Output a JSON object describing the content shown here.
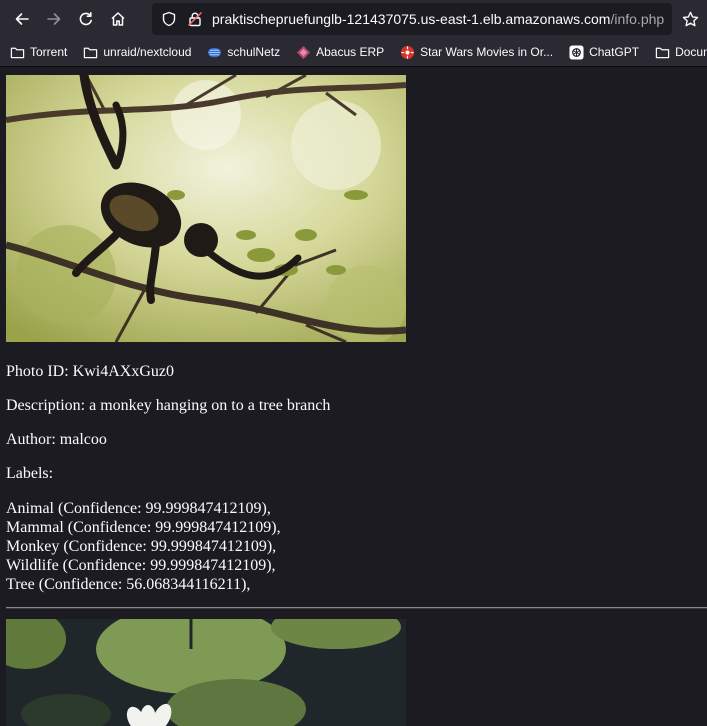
{
  "browser": {
    "url_host": "praktischepruefunglb-121437075.us-east-1.elb.amazonaws.com",
    "url_path": "/info.php"
  },
  "bookmarks": [
    {
      "label": "Torrent",
      "icon": "folder-icon"
    },
    {
      "label": "unraid/nextcloud",
      "icon": "folder-icon"
    },
    {
      "label": "schulNetz",
      "icon": "schulnetz-icon"
    },
    {
      "label": "Abacus ERP",
      "icon": "abacus-icon"
    },
    {
      "label": "Star Wars Movies in Or...",
      "icon": "star-wars-icon"
    },
    {
      "label": "ChatGPT",
      "icon": "chatgpt-icon"
    },
    {
      "label": "DocumentDe",
      "icon": "folder-icon"
    }
  ],
  "photo": {
    "id_line": "Photo ID: Kwi4AXxGuz0",
    "description_line": "Description: a monkey hanging on to a tree branch",
    "author_line": "Author: malcoo",
    "labels_heading": "Labels:",
    "labels": [
      "Animal (Confidence: 99.999847412109),",
      "Mammal (Confidence: 99.999847412109),",
      "Monkey (Confidence: 99.999847412109),",
      "Wildlife (Confidence: 99.999847412109),",
      "Tree (Confidence: 56.068344116211),"
    ]
  },
  "colors": {
    "page_background": "#1c1b22",
    "chrome_background": "#2b2a33",
    "text": "#fbfbfe"
  }
}
